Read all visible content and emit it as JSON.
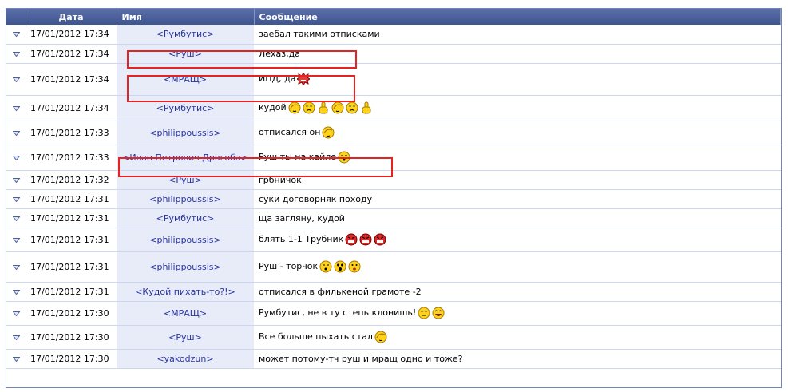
{
  "header": {
    "date": "Дата",
    "name": "Имя",
    "message": "Сообщение"
  },
  "rows": [
    {
      "date": "17/01/2012 17:34",
      "name": "<Румбутис>",
      "text": "заебал такими отписками",
      "smileys": []
    },
    {
      "date": "17/01/2012 17:34",
      "name": "<Руш>",
      "text": "Лехаз,да",
      "smileys": []
    },
    {
      "date": "17/01/2012 17:34",
      "name": "<МРАЩ>",
      "text": "ИПД, да",
      "smileys": [
        "angry-spiky-icon"
      ]
    },
    {
      "date": "17/01/2012 17:34",
      "name": "<Румбутис>",
      "text": "кудой",
      "smileys": [
        "facepalm-icon",
        "sad-face-icon",
        "middle-finger-icon",
        "facepalm-icon",
        "sad-face-icon",
        "middle-finger-icon"
      ]
    },
    {
      "date": "17/01/2012 17:33",
      "name": "<philippoussis>",
      "text": "отписался он",
      "smileys": [
        "facepalm-icon"
      ]
    },
    {
      "date": "17/01/2012 17:33",
      "name": "<Иван Петрович Дрогоба>",
      "text": "Руш ты на кайле",
      "smileys": [
        "stoned-face-icon"
      ]
    },
    {
      "date": "17/01/2012 17:32",
      "name": "<Руш>",
      "text": "грбничок",
      "smileys": []
    },
    {
      "date": "17/01/2012 17:31",
      "name": "<philippoussis>",
      "text": "суки договорняк походу",
      "smileys": []
    },
    {
      "date": "17/01/2012 17:31",
      "name": "<Румбутис>",
      "text": "ща загляну, кудой",
      "smileys": []
    },
    {
      "date": "17/01/2012 17:31",
      "name": "<philippoussis>",
      "text": "блять 1-1 Трубник",
      "smileys": [
        "red-angry-icon",
        "red-angry-icon",
        "red-angry-icon"
      ]
    },
    {
      "date": "17/01/2012 17:31",
      "name": "<philippoussis>",
      "text": "Руш - торчок",
      "smileys": [
        "stoned-face-icon",
        "shocked-face-icon",
        "surprised-face-icon"
      ]
    },
    {
      "date": "17/01/2012 17:31",
      "name": "<Кудой пихать-то?!>",
      "text": "отписался в филькеной грамоте -2",
      "smileys": []
    },
    {
      "date": "17/01/2012 17:30",
      "name": "<МРАЩ>",
      "text": "Румбутис, не в ту степь клонишь!",
      "smileys": [
        "thinking-face-icon",
        "laughing-face-icon"
      ]
    },
    {
      "date": "17/01/2012 17:30",
      "name": "<Руш>",
      "text": "Все больше пыхать стал",
      "smileys": [
        "facepalm-icon"
      ]
    },
    {
      "date": "17/01/2012 17:30",
      "name": "<yakodzun>",
      "text": "может потому-тч руш и мращ одно и тоже?",
      "smileys": []
    }
  ],
  "colors": {
    "header_bg": "#4a5e9b",
    "name_text": "#2733a3",
    "name_bg": "#e8ecf8",
    "highlight": "#e62222"
  }
}
